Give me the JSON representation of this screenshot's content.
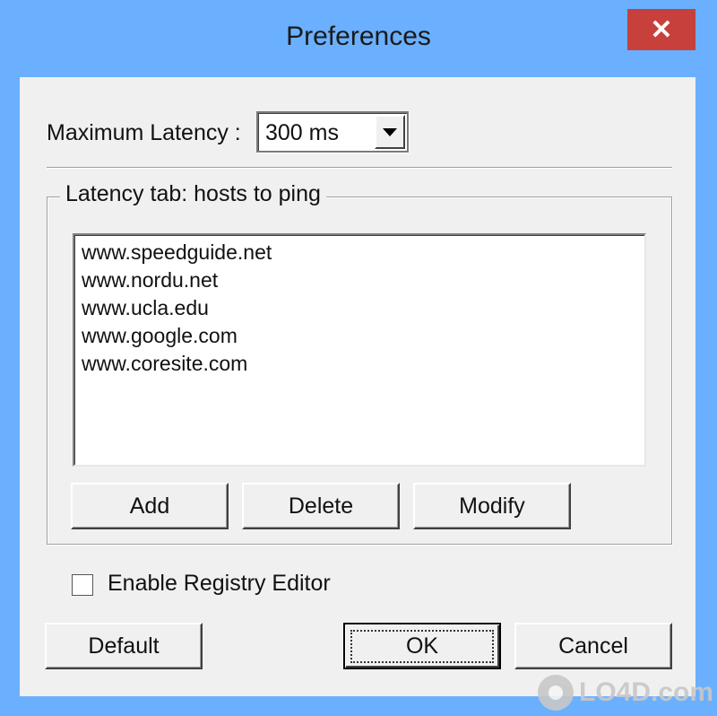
{
  "window": {
    "title": "Preferences",
    "close_glyph": "✕"
  },
  "latency": {
    "label": "Maximum Latency :",
    "selected": "300 ms"
  },
  "hosts_group": {
    "title": "Latency tab: hosts to ping",
    "items": [
      "www.speedguide.net",
      "www.nordu.net",
      "www.ucla.edu",
      "www.google.com",
      "www.coresite.com"
    ],
    "add_label": "Add",
    "delete_label": "Delete",
    "modify_label": "Modify"
  },
  "registry": {
    "label": "Enable Registry Editor",
    "checked": false
  },
  "footer": {
    "default_label": "Default",
    "ok_label": "OK",
    "cancel_label": "Cancel"
  },
  "watermark": {
    "text": "LO4D.com"
  },
  "colors": {
    "title_bar": "#6ab0ff",
    "close_button": "#c7403b",
    "dialog_face": "#f0f0f0"
  }
}
